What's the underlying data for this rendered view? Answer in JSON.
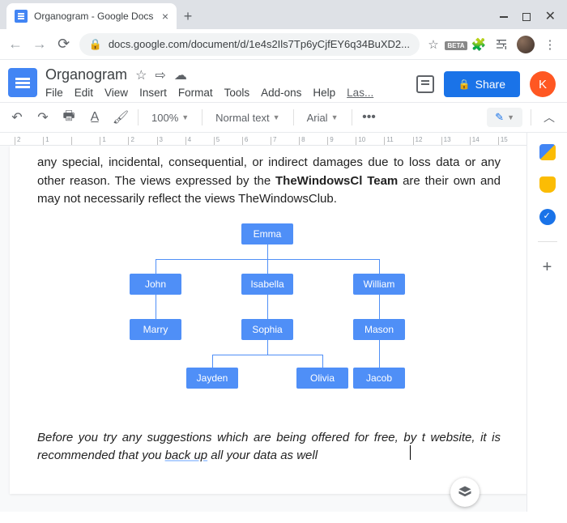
{
  "browser": {
    "tab_title": "Organogram - Google Docs",
    "url": "docs.google.com/document/d/1e4s2Ils7Tp6yCjfEY6q34BuXD2..."
  },
  "header": {
    "doc_title": "Organogram",
    "menus": {
      "file": "File",
      "edit": "Edit",
      "view": "View",
      "insert": "Insert",
      "format": "Format",
      "tools": "Tools",
      "addons": "Add-ons",
      "help": "Help",
      "last": "Las..."
    },
    "share_label": "Share",
    "user_initial": "K"
  },
  "toolbar": {
    "zoom": "100%",
    "style": "Normal text",
    "font": "Arial",
    "more": "•••"
  },
  "ruler_labels": [
    "2",
    "1",
    "",
    "1",
    "2",
    "3",
    "4",
    "5",
    "6",
    "7",
    "8",
    "9",
    "10",
    "11",
    "12",
    "13",
    "14",
    "15"
  ],
  "document": {
    "para1_a": "any special, incidental, consequential, or indirect damages due to loss",
    "para1_b": "data or any other reason. The views expressed by the ",
    "bold1": "TheWindowsCl",
    "bold2": "Team",
    "para1_c": " are their own and may not necessarily reflect the views",
    "para1_d": "TheWindowsClub.",
    "para2_a": "Before you try any suggestions which are being offered for free, by t",
    "para2_b": "website, it is recommended that you ",
    "para2_u": "back up",
    "para2_c": " all your data as well"
  },
  "chart_data": {
    "type": "org-hierarchy",
    "title": "Organogram",
    "nodes": [
      {
        "id": "emma",
        "label": "Emma",
        "parent": null,
        "level": 0
      },
      {
        "id": "john",
        "label": "John",
        "parent": "emma",
        "level": 1
      },
      {
        "id": "isabella",
        "label": "Isabella",
        "parent": "emma",
        "level": 1
      },
      {
        "id": "william",
        "label": "William",
        "parent": "emma",
        "level": 1
      },
      {
        "id": "marry",
        "label": "Marry",
        "parent": "john",
        "level": 2
      },
      {
        "id": "sophia",
        "label": "Sophia",
        "parent": "isabella",
        "level": 2
      },
      {
        "id": "mason",
        "label": "Mason",
        "parent": "william",
        "level": 2
      },
      {
        "id": "jayden",
        "label": "Jayden",
        "parent": "sophia",
        "level": 3
      },
      {
        "id": "olivia",
        "label": "Olivia",
        "parent": "sophia",
        "level": 3
      },
      {
        "id": "jacob",
        "label": "Jacob",
        "parent": "mason",
        "level": 3
      }
    ]
  }
}
